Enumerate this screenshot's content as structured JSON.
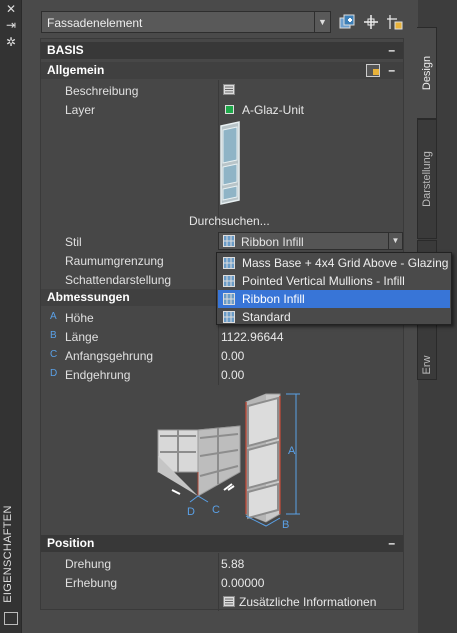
{
  "palette_title": "EIGENSCHAFTEN",
  "toolbar": {
    "object_type": "Fassadenelement"
  },
  "tabs": [
    "Design",
    "Darstellung",
    "Erw"
  ],
  "basis": {
    "header": "BASIS",
    "allgemein": {
      "header": "Allgemein",
      "beschreibung_label": "Beschreibung",
      "layer_label": "Layer",
      "layer_value": "A-Glaz-Unit",
      "layer_color": "#1fa84a",
      "browse_label": "Durchsuchen...",
      "stil_label": "Stil",
      "stil_value": "Ribbon Infill",
      "raumbegrenzung_label": "Raumumgrenzung",
      "schatten_label": "Schattendarstellung"
    }
  },
  "style_dropdown": {
    "options": [
      "Mass Base + 4x4 Grid Above - Glazing",
      "Pointed Vertical Mullions - Infill",
      "Ribbon Infill",
      "Standard"
    ],
    "selected": "Ribbon Infill"
  },
  "abmessungen": {
    "header": "Abmessungen",
    "rows": [
      {
        "letter": "A",
        "label": "Höhe",
        "value": ""
      },
      {
        "letter": "B",
        "label": "Länge",
        "value": "1122.96644"
      },
      {
        "letter": "C",
        "label": "Anfangsgehrung",
        "value": "0.00"
      },
      {
        "letter": "D",
        "label": "Endgehrung",
        "value": "0.00"
      }
    ],
    "diagram_labels": {
      "a": "A",
      "b": "B",
      "c": "C",
      "d": "D"
    }
  },
  "position": {
    "header": "Position",
    "drehung_label": "Drehung",
    "drehung_value": "5.88",
    "erhebung_label": "Erhebung",
    "erhebung_value": "0.00000",
    "extra_label": "Zusätzliche Informationen"
  },
  "colors": {
    "selection": "#3875d7",
    "letter": "#5aa0e6",
    "dimension": "#5aa0e6"
  }
}
